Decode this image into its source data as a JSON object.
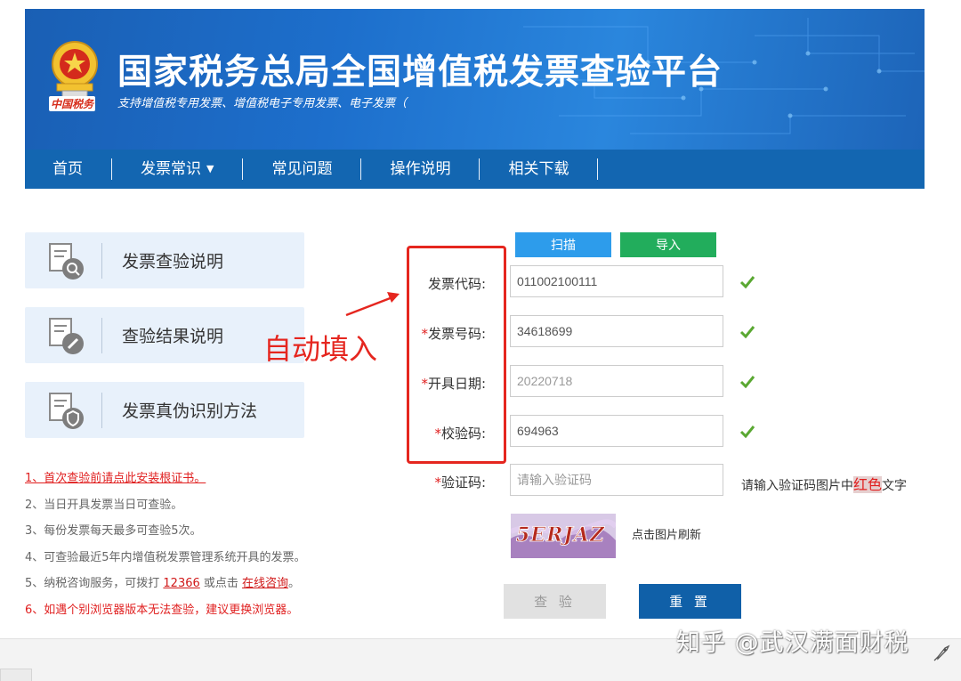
{
  "header": {
    "emblem_caption": "中国税务",
    "title": "国家税务总局全国增值税发票查验平台",
    "subtitle": "支持增值税专用发票、增值税电子专用发票、电子发票（"
  },
  "nav": {
    "items": [
      "首页",
      "发票常识",
      "常见问题",
      "操作说明",
      "相关下载"
    ]
  },
  "left_cards": [
    {
      "label": "发票查验说明",
      "icon": "search-document-icon"
    },
    {
      "label": "查验结果说明",
      "icon": "edit-document-icon"
    },
    {
      "label": "发票真伪识别方法",
      "icon": "shield-document-icon"
    }
  ],
  "notes": {
    "n1": "1、首次查验前请点此安装根证书。",
    "n2": "2、当日开具发票当日可查验。",
    "n3": "3、每份发票每天最多可查验5次。",
    "n4": "4、可查验最近5年内增值税发票管理系统开具的发票。",
    "n5_prefix": "5、纳税咨询服务，可拨打 ",
    "n5_phone": "12366",
    "n5_middle": " 或点击 ",
    "n5_link": "在线咨询",
    "n5_suffix": "。",
    "n6": "6、如遇个别浏览器版本无法查验，建议更换浏览器。"
  },
  "annotation": {
    "text": "自动填入",
    "color": "#e5261f"
  },
  "buttons": {
    "scan": "扫描",
    "import": "导入",
    "query": "查 验",
    "reset": "重 置"
  },
  "form": {
    "code_label": "发票代码:",
    "code_value": "011002100111",
    "number_label": "发票号码:",
    "number_value": "34618699",
    "date_label": "开具日期:",
    "date_value": "20220718",
    "check_label": "校验码:",
    "check_value": "694963",
    "captcha_label": "验证码:",
    "captcha_placeholder": "请输入验证码",
    "required_mark": "*"
  },
  "captcha": {
    "image_text": "5ERJAZ",
    "hint_prefix": "请输入验证码图片中",
    "hint_color_word": "红色",
    "hint_suffix": "文字",
    "refresh": "点击图片刷新"
  },
  "watermark": "知乎 @武汉满面财税",
  "colors": {
    "brand_blue": "#1366b1",
    "scan_blue": "#2d9ceb",
    "import_green": "#22ad5c",
    "check_green": "#5aa832",
    "alert_red": "#e02020"
  }
}
